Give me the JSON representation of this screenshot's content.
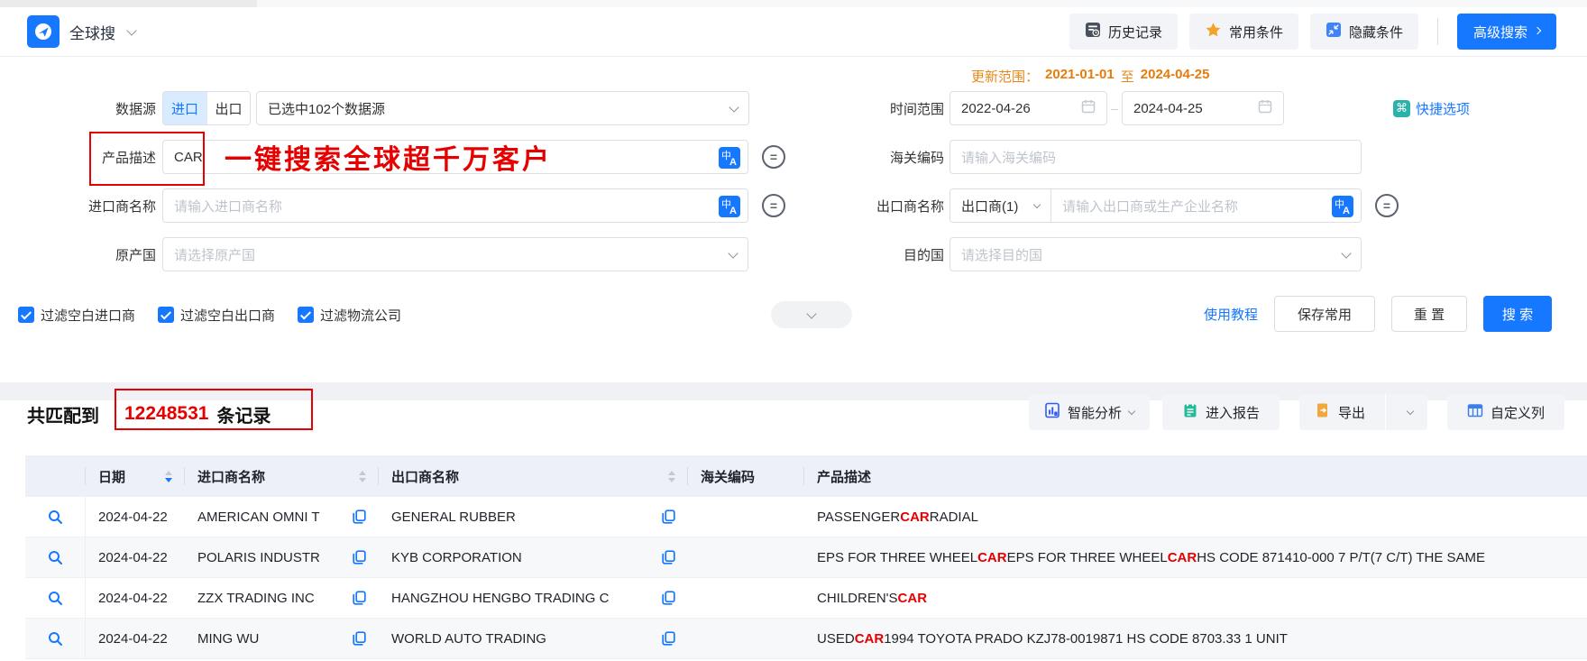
{
  "topbar": {
    "app_title": "全球搜",
    "history": "历史记录",
    "favorites": "常用条件",
    "hide_conditions": "隐藏条件",
    "advanced_search": "高级搜索"
  },
  "form": {
    "datasource": {
      "label": "数据源",
      "import_tab": "进口",
      "export_tab": "出口",
      "selected_value": "已选中102个数据源"
    },
    "product": {
      "label": "产品描述",
      "value": "CAR"
    },
    "importer": {
      "label": "进口商名称",
      "placeholder": "请输入进口商名称"
    },
    "origin": {
      "label": "原产国",
      "placeholder": "请选择原产国"
    },
    "update_range": {
      "prefix": "更新范围：",
      "from": "2021-01-01",
      "to_word": "至",
      "to": "2024-04-25"
    },
    "time_range": {
      "label": "时间范围",
      "from": "2022-04-26",
      "separator": "–",
      "to": "2024-04-25",
      "quick_options": "快捷选项"
    },
    "hs_code": {
      "label": "海关编码",
      "placeholder": "请输入海关编码"
    },
    "exporter": {
      "label": "出口商名称",
      "type_value": "出口商(1)",
      "placeholder": "请输入出口商或生产企业名称"
    },
    "destination": {
      "label": "目的国",
      "placeholder": "请选择目的国"
    },
    "filters": {
      "f1": "过滤空白进口商",
      "f2": "过滤空白出口商",
      "f3": "过滤物流公司"
    },
    "actions": {
      "tutorial": "使用教程",
      "save": "保存常用",
      "reset": "重 置",
      "search": "搜 索"
    }
  },
  "annotations": {
    "product_note": "一键搜索全球超千万客户"
  },
  "results": {
    "summary": {
      "prefix": "共匹配到",
      "count": "12248531",
      "suffix": "条记录"
    },
    "toolbar": {
      "analysis": "智能分析",
      "report": "进入报告",
      "export": "导出",
      "custom_columns": "自定义列"
    },
    "table": {
      "headers": [
        "日期",
        "进口商名称",
        "出口商名称",
        "海关编码",
        "产品描述"
      ],
      "rows": [
        {
          "date": "2024-04-22",
          "importer": "AMERICAN OMNI T",
          "exporter": "GENERAL RUBBER",
          "hs_code": "",
          "desc": [
            [
              "PASSENGER ",
              0
            ],
            [
              "CAR",
              1
            ],
            [
              " RADIAL",
              0
            ]
          ]
        },
        {
          "date": "2024-04-22",
          "importer": "POLARIS INDUSTR",
          "exporter": "KYB CORPORATION",
          "hs_code": "",
          "desc": [
            [
              "EPS FOR THREE WHEEL ",
              0
            ],
            [
              "CAR",
              1
            ],
            [
              " EPS FOR THREE WHEEL ",
              0
            ],
            [
              "CAR",
              1
            ],
            [
              " HS CODE 871410-000 7 P/T(7 C/T) THE SAME",
              0
            ]
          ]
        },
        {
          "date": "2024-04-22",
          "importer": "ZZX TRADING INC",
          "exporter": "HANGZHOU HENGBO TRADING C",
          "hs_code": "",
          "desc": [
            [
              "CHILDREN'S ",
              0
            ],
            [
              "CAR",
              1
            ]
          ]
        },
        {
          "date": "2024-04-22",
          "importer": "MING WU",
          "exporter": "WORLD AUTO TRADING",
          "hs_code": "",
          "desc": [
            [
              "USED ",
              0
            ],
            [
              "CAR",
              1
            ],
            [
              " 1994 TOYOTA PRADO KZJ78-0019871 HS CODE 8703.33 1 UNIT",
              0
            ]
          ]
        }
      ]
    }
  },
  "icons": {
    "translate_cn": "中",
    "translate_en": "A",
    "exclude": "=",
    "quick": "⌘"
  },
  "colors": {
    "primary": "#1677ff",
    "highlight_red": "#e60000",
    "update_orange": "#e8871c",
    "button_bg": "#f2f4f8",
    "header_bg": "#edf1f7"
  }
}
